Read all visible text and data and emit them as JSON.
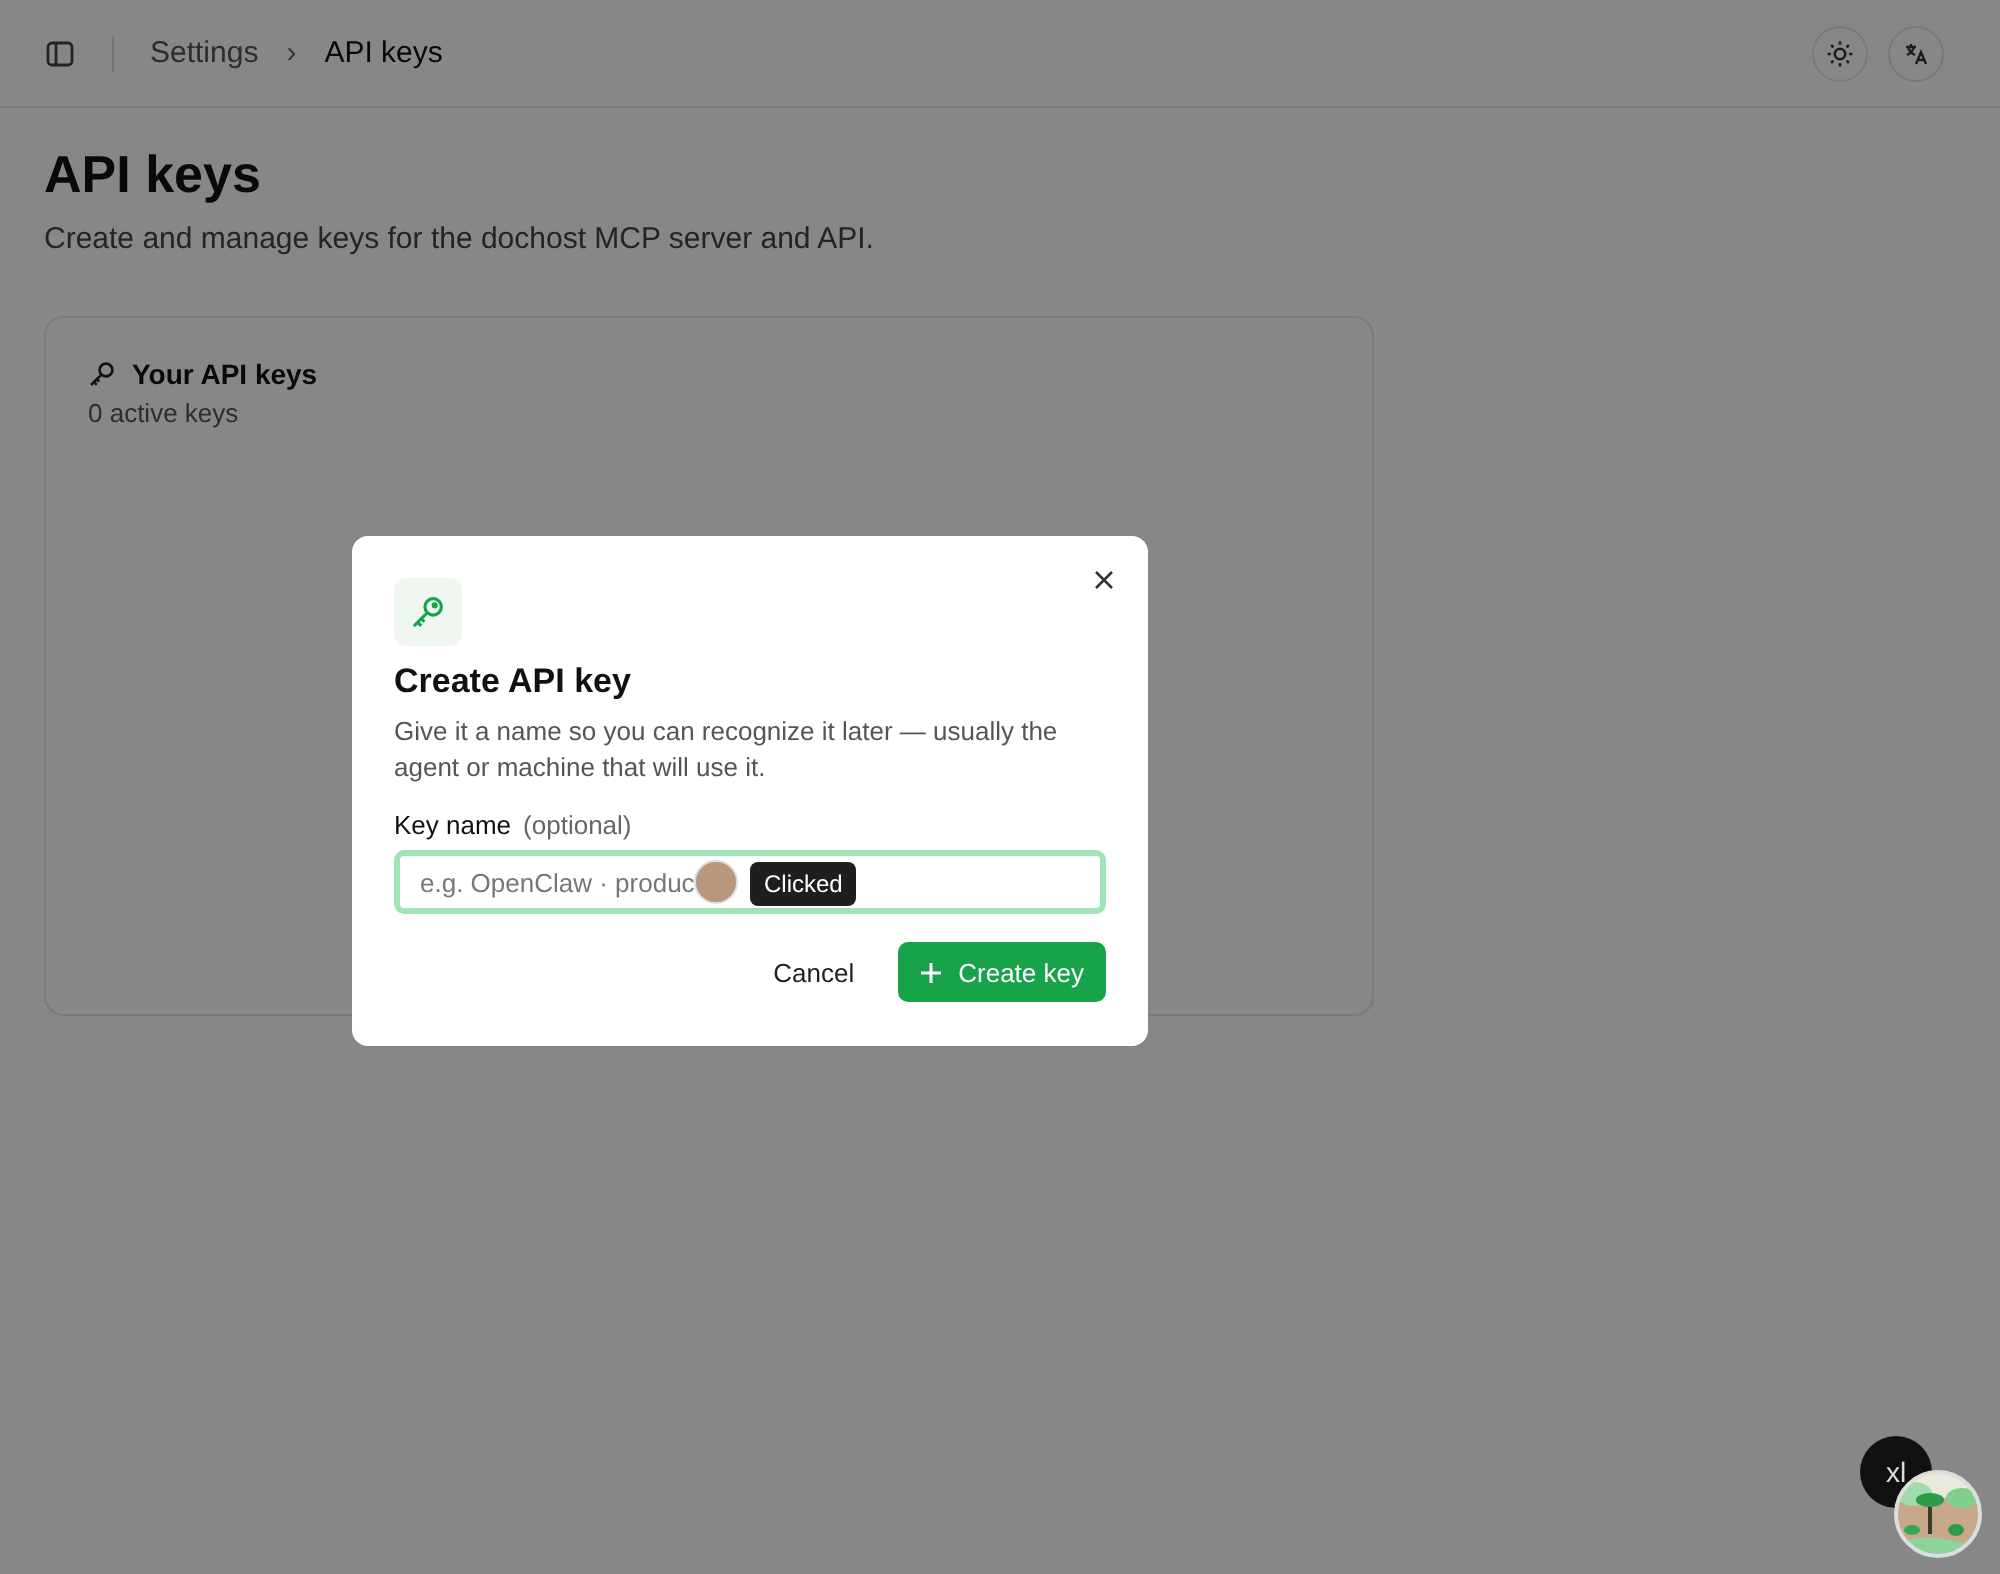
{
  "header": {
    "breadcrumb": [
      {
        "label": "Settings"
      },
      {
        "label": "API keys"
      }
    ],
    "separator": "›"
  },
  "page": {
    "title": "API keys",
    "subtitle": "Create and manage keys for the dochost MCP server and API."
  },
  "card": {
    "title": "Your API keys",
    "count": "0 active keys"
  },
  "dialog": {
    "title": "Create API key",
    "description": "Give it a name so you can recognize it later — usually the agent or machine that will use it.",
    "field": {
      "label": "Key name",
      "hint": "(optional)",
      "placeholder": "e.g. OpenClaw · produc",
      "focused": true
    },
    "buttons": [
      {
        "label": "Cancel",
        "kind": "secondary"
      },
      {
        "label": "Create key",
        "kind": "primary"
      }
    ]
  },
  "cursor": {
    "tooltip": "Clicked"
  },
  "user_badge": {
    "initials": "xl"
  }
}
